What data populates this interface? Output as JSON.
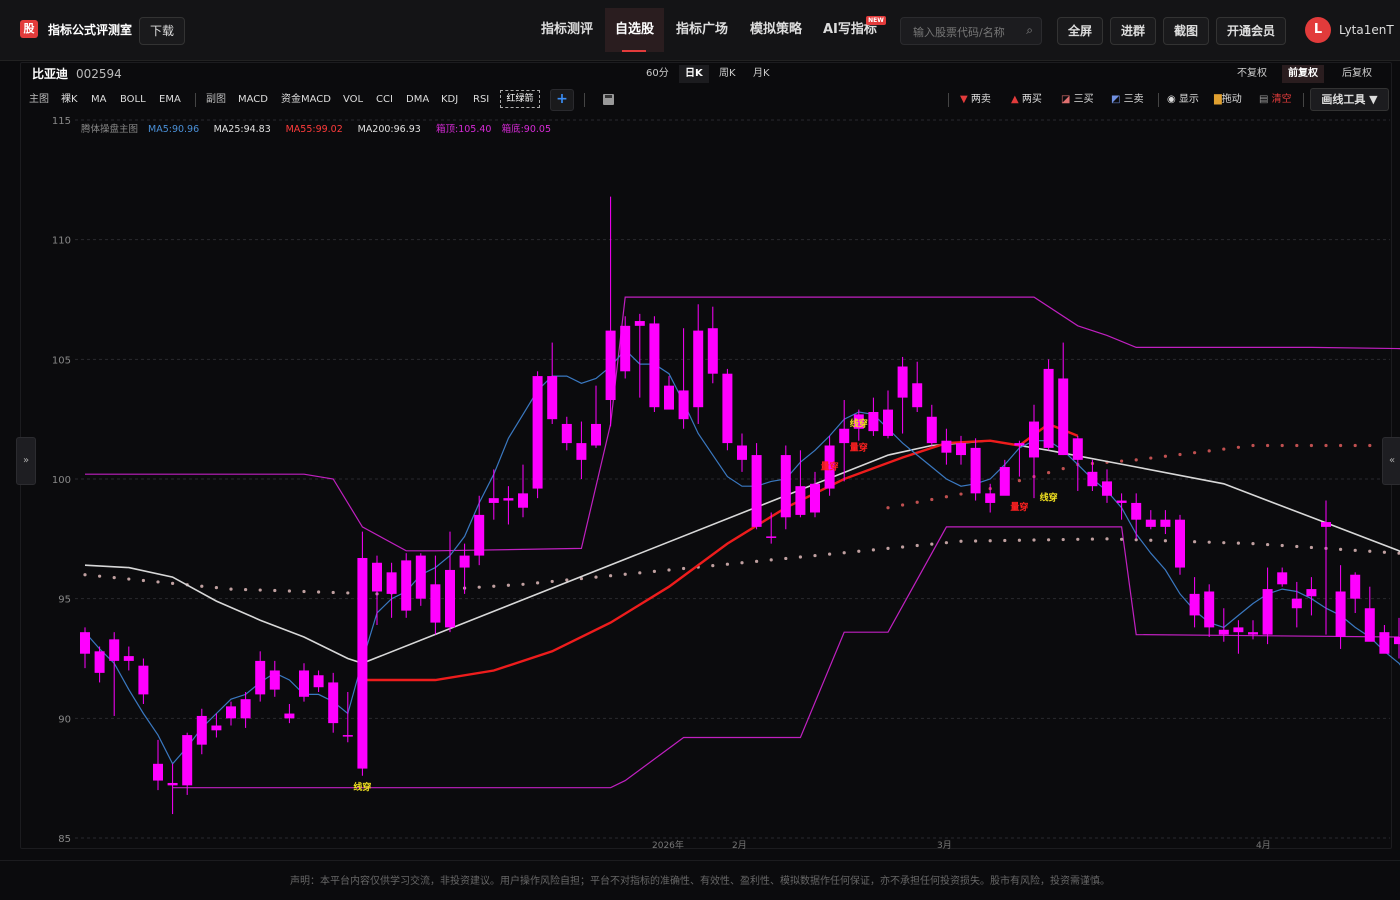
{
  "app": {
    "logo_glyph": "股",
    "title": "指标公式评测室",
    "download_label": "下载",
    "nav": [
      "指标测评",
      "自选股",
      "指标广场",
      "模拟策略",
      "AI写指标"
    ],
    "nav_active_index": 1,
    "new_badge": "NEW",
    "search_placeholder": "输入股票代码/名称",
    "buttons": [
      "全屏",
      "进群",
      "截图",
      "开通会员"
    ],
    "avatar_letter": "L",
    "username": "Lyta1enT"
  },
  "stock": {
    "name": "比亚迪",
    "code": "002594"
  },
  "periods": [
    "60分",
    "日K",
    "周K",
    "月K"
  ],
  "period_active_index": 1,
  "adjust": [
    "不复权",
    "前复权",
    "后复权"
  ],
  "adjust_active_index": 1,
  "indicators": {
    "main_label": "主图",
    "main": [
      "裸K",
      "MA",
      "BOLL",
      "EMA"
    ],
    "sub_label": "副图",
    "sub": [
      "MACD",
      "资金MACD",
      "VOL",
      "CCI",
      "DMA",
      "KDJ",
      "RSI"
    ],
    "custom": "红绿箭"
  },
  "tools": [
    "两卖",
    "两买",
    "三买",
    "三卖",
    "显示",
    "拖动",
    "清空"
  ],
  "draw_tools_label": "画线工具 ▼",
  "side_tabs": [
    "»",
    "«"
  ],
  "legend": {
    "main_name": "腾体操盘主图",
    "items": [
      {
        "label": "MA5:90.96",
        "color": "#4a8fd6"
      },
      {
        "label": "MA25:94.83",
        "color": "#e0e0e0"
      },
      {
        "label": "MA55:99.02",
        "color": "#ff3b3b"
      },
      {
        "label": "MA200:96.93",
        "color": "#e0e0e0"
      },
      {
        "label": "箱顶:105.40",
        "color": "#d62ad6"
      },
      {
        "label": "箱底:90.05",
        "color": "#d62ad6"
      }
    ]
  },
  "chart_data": {
    "type": "candlestick",
    "y_ticks": [
      115,
      110,
      105,
      100,
      95,
      90,
      85
    ],
    "ylim": [
      85,
      115
    ],
    "x_tick_labels": [
      "2026年",
      "2月",
      "3月",
      "4月"
    ],
    "candles": [
      [
        93.6,
        92.7,
        93.8,
        92.1
      ],
      [
        92.8,
        91.9,
        93.0,
        91.5
      ],
      [
        92.4,
        93.3,
        93.6,
        90.1
      ],
      [
        92.6,
        92.4,
        93.0,
        92.0
      ],
      [
        92.2,
        91.0,
        92.5,
        90.6
      ],
      [
        88.1,
        87.4,
        89.1,
        87.0
      ],
      [
        87.2,
        87.3,
        88.1,
        86.0
      ],
      [
        87.2,
        89.3,
        89.4,
        86.8
      ],
      [
        88.9,
        90.1,
        90.4,
        88.5
      ],
      [
        89.7,
        89.5,
        90.2,
        89.2
      ],
      [
        90.0,
        90.5,
        90.7,
        89.7
      ],
      [
        90.0,
        90.8,
        91.1,
        89.6
      ],
      [
        91.0,
        92.4,
        92.8,
        90.7
      ],
      [
        91.2,
        92.0,
        92.4,
        90.9
      ],
      [
        90.2,
        90.0,
        90.6,
        89.8
      ],
      [
        90.9,
        92.0,
        92.3,
        90.7
      ],
      [
        91.3,
        91.8,
        92.0,
        91.1
      ],
      [
        89.8,
        91.5,
        91.9,
        89.4
      ],
      [
        89.3,
        89.3,
        91.1,
        89.0
      ],
      [
        87.9,
        96.7,
        97.8,
        87.6
      ],
      [
        95.3,
        96.5,
        96.8,
        93.9
      ],
      [
        96.1,
        95.2,
        96.5,
        94.2
      ],
      [
        94.5,
        96.6,
        96.9,
        94.2
      ],
      [
        96.8,
        95.0,
        96.9,
        94.7
      ],
      [
        95.6,
        94.0,
        96.8,
        93.5
      ],
      [
        93.8,
        96.2,
        97.8,
        93.6
      ],
      [
        96.3,
        96.8,
        97.3,
        95.2
      ],
      [
        96.8,
        98.5,
        99.3,
        96.4
      ],
      [
        99.2,
        99.0,
        100.4,
        98.3
      ],
      [
        99.1,
        99.2,
        99.7,
        98.1
      ],
      [
        98.8,
        99.4,
        100.6,
        98.4
      ],
      [
        99.6,
        104.3,
        104.5,
        99.2
      ],
      [
        104.3,
        102.5,
        105.7,
        102.3
      ],
      [
        102.3,
        101.5,
        102.6,
        101.2
      ],
      [
        101.5,
        100.8,
        102.4,
        100.0
      ],
      [
        101.4,
        102.3,
        103.9,
        101.3
      ],
      [
        103.3,
        106.2,
        111.8,
        102.2
      ],
      [
        104.5,
        106.4,
        106.8,
        104.2
      ],
      [
        106.4,
        106.6,
        106.9,
        103.4
      ],
      [
        106.5,
        103.0,
        106.8,
        102.8
      ],
      [
        102.9,
        103.9,
        104.3,
        103.0
      ],
      [
        102.5,
        103.7,
        106.3,
        102.1
      ],
      [
        103.0,
        106.2,
        107.3,
        102.3
      ],
      [
        106.3,
        104.4,
        107.2,
        104.0
      ],
      [
        104.4,
        101.5,
        104.6,
        101.2
      ],
      [
        101.4,
        100.8,
        101.9,
        100.3
      ],
      [
        101.0,
        98.0,
        101.5,
        97.9
      ],
      [
        97.6,
        97.6,
        98.6,
        97.3
      ],
      [
        98.4,
        101.0,
        101.4,
        97.9
      ],
      [
        98.5,
        99.7,
        101.2,
        98.4
      ],
      [
        98.6,
        99.8,
        100.3,
        98.4
      ],
      [
        99.6,
        101.4,
        101.8,
        99.3
      ],
      [
        101.5,
        102.1,
        103.3,
        99.9
      ],
      [
        102.1,
        102.7,
        102.9,
        101.6
      ],
      [
        102.0,
        102.8,
        103.4,
        101.8
      ],
      [
        102.9,
        101.8,
        103.7,
        101.7
      ],
      [
        103.4,
        104.7,
        105.1,
        101.9
      ],
      [
        104.0,
        103.0,
        104.9,
        102.8
      ],
      [
        102.6,
        101.5,
        103.1,
        101.4
      ],
      [
        101.6,
        101.1,
        102.1,
        100.6
      ],
      [
        101.0,
        101.5,
        101.8,
        100.6
      ],
      [
        101.3,
        99.4,
        101.7,
        99.1
      ],
      [
        99.4,
        99.0,
        99.8,
        98.6
      ],
      [
        99.3,
        100.5,
        100.8,
        99.4
      ],
      [
        101.4,
        101.5,
        101.6,
        100.1
      ],
      [
        100.9,
        102.4,
        103.1,
        99.2
      ],
      [
        104.6,
        101.3,
        105.0,
        101.2
      ],
      [
        101.0,
        104.2,
        105.7,
        101.0
      ],
      [
        101.7,
        100.8,
        101.8,
        99.5
      ],
      [
        99.7,
        100.3,
        100.8,
        99.5
      ],
      [
        99.3,
        99.9,
        100.4,
        99.0
      ],
      [
        99.0,
        99.1,
        99.4,
        98.3
      ],
      [
        99.0,
        98.3,
        99.4,
        97.5
      ],
      [
        98.3,
        98.0,
        98.7,
        97.9
      ],
      [
        98.0,
        98.3,
        98.7,
        97.7
      ],
      [
        98.3,
        96.3,
        98.5,
        96.0
      ],
      [
        95.2,
        94.3,
        95.9,
        93.8
      ],
      [
        95.3,
        93.8,
        95.6,
        93.4
      ],
      [
        93.5,
        93.7,
        94.6,
        93.2
      ],
      [
        93.6,
        93.8,
        94.1,
        92.7
      ],
      [
        93.6,
        93.5,
        94.1,
        93.3
      ],
      [
        93.5,
        95.4,
        96.3,
        93.1
      ],
      [
        95.6,
        96.1,
        96.3,
        95.5
      ],
      [
        94.6,
        95.0,
        95.7,
        93.8
      ],
      [
        95.1,
        95.4,
        95.9,
        94.3
      ],
      [
        98.2,
        98.0,
        99.1,
        93.5
      ],
      [
        95.3,
        93.4,
        96.4,
        92.9
      ],
      [
        95.0,
        96.0,
        96.1,
        94.4
      ],
      [
        93.2,
        94.6,
        95.5,
        93.6
      ],
      [
        93.6,
        92.7,
        93.9,
        93.1
      ],
      [
        93.1,
        93.4,
        94.2,
        92.5
      ],
      [
        91.3,
        91.2,
        91.8,
        91.0
      ],
      [
        90.8,
        91.6,
        91.9,
        89.8
      ],
      [
        90.4,
        90.9,
        91.2,
        89.7
      ],
      [
        89.7,
        89.9,
        90.4,
        89.1
      ],
      [
        89.9,
        91.5,
        91.6,
        89.3
      ]
    ],
    "ma5": [
      93.6,
      92.9,
      92.3,
      91.2,
      90.2,
      89.3,
      88.1,
      88.8,
      89.6,
      90.2,
      90.8,
      91.0,
      91.5,
      91.9,
      91.6,
      91.0,
      91.0,
      90.7,
      90.2,
      92.4,
      94.4,
      95.0,
      95.3,
      96.0,
      96.3,
      96.8,
      97.6,
      99.0,
      100.2,
      101.7,
      102.7,
      103.7,
      104.3,
      104.3,
      104.0,
      104.2,
      104.7,
      105.4,
      104.8,
      104.8,
      104.4,
      103.2,
      101.9,
      101.0,
      100.1,
      99.7,
      99.7,
      99.9,
      100.0,
      100.7,
      101.2,
      101.8,
      102.5,
      102.8,
      102.7,
      102.1,
      101.5,
      101.0,
      100.5,
      100.0,
      99.7,
      99.8,
      100.0,
      100.6,
      101.3,
      101.6,
      101.6,
      101.2,
      100.6,
      100.0,
      99.5,
      98.8,
      97.7,
      96.9,
      96.2,
      95.2,
      94.5,
      94.0,
      93.8,
      94.3,
      94.8,
      95.2,
      95.4,
      95.3,
      95.0,
      94.6,
      94.3,
      93.8,
      93.4,
      92.8,
      92.3,
      91.5,
      90.9,
      90.3,
      90.4,
      90.9
    ],
    "ma25": [
      {
        "i": 0,
        "v": 96.4
      },
      {
        "i": 3,
        "v": 96.3
      },
      {
        "i": 6,
        "v": 95.9
      },
      {
        "i": 9,
        "v": 94.9
      },
      {
        "i": 12,
        "v": 94.1
      },
      {
        "i": 15,
        "v": 93.4
      },
      {
        "i": 18,
        "v": 92.5
      },
      {
        "i": 19,
        "v": 92.3
      },
      {
        "i": 55,
        "v": 101.0
      },
      {
        "i": 58,
        "v": 101.4
      },
      {
        "i": 62,
        "v": 101.6
      },
      {
        "i": 66,
        "v": 101.2
      },
      {
        "i": 72,
        "v": 100.5
      },
      {
        "i": 78,
        "v": 99.8
      },
      {
        "i": 84,
        "v": 98.4
      },
      {
        "i": 90,
        "v": 97.0
      },
      {
        "i": 96,
        "v": 94.8
      }
    ],
    "ma55": [
      {
        "i": 19,
        "v": 91.6
      },
      {
        "i": 24,
        "v": 91.6
      },
      {
        "i": 28,
        "v": 92.0
      },
      {
        "i": 32,
        "v": 92.8
      },
      {
        "i": 36,
        "v": 94.0
      },
      {
        "i": 40,
        "v": 95.5
      },
      {
        "i": 44,
        "v": 97.3
      },
      {
        "i": 48,
        "v": 98.8
      },
      {
        "i": 52,
        "v": 100.0
      },
      {
        "i": 56,
        "v": 100.9
      },
      {
        "i": 59,
        "v": 101.5
      },
      {
        "i": 62,
        "v": 101.6
      },
      {
        "i": 64,
        "v": 101.4
      },
      {
        "i": 66,
        "v": 102.3
      },
      {
        "i": 68,
        "v": 101.8
      }
    ],
    "ma200": [
      {
        "i": 0,
        "v": 96.0
      },
      {
        "i": 10,
        "v": 95.4
      },
      {
        "i": 20,
        "v": 95.2
      },
      {
        "i": 30,
        "v": 95.6
      },
      {
        "i": 40,
        "v": 96.2
      },
      {
        "i": 50,
        "v": 96.8
      },
      {
        "i": 60,
        "v": 97.4
      },
      {
        "i": 70,
        "v": 97.5
      },
      {
        "i": 80,
        "v": 97.3
      },
      {
        "i": 90,
        "v": 96.9
      },
      {
        "i": 96,
        "v": 96.9
      }
    ],
    "box_top": [
      {
        "i": 0,
        "v": 100.2
      },
      {
        "i": 15,
        "v": 100.2
      },
      {
        "i": 17,
        "v": 100.0
      },
      {
        "i": 19,
        "v": 98.0
      },
      {
        "i": 22,
        "v": 97.0
      },
      {
        "i": 24,
        "v": 97.0
      },
      {
        "i": 34,
        "v": 97.1
      },
      {
        "i": 36,
        "v": 102.3
      },
      {
        "i": 37,
        "v": 107.6
      },
      {
        "i": 65,
        "v": 107.6
      },
      {
        "i": 68,
        "v": 106.4
      },
      {
        "i": 70,
        "v": 106.0
      },
      {
        "i": 72,
        "v": 105.5
      },
      {
        "i": 84,
        "v": 105.5
      },
      {
        "i": 96,
        "v": 105.4
      }
    ],
    "box_bottom": [
      {
        "i": 6,
        "v": 87.1
      },
      {
        "i": 36,
        "v": 87.1
      },
      {
        "i": 37,
        "v": 87.4
      },
      {
        "i": 41,
        "v": 89.2
      },
      {
        "i": 49,
        "v": 89.2
      },
      {
        "i": 52,
        "v": 93.6
      },
      {
        "i": 55,
        "v": 93.6
      },
      {
        "i": 59,
        "v": 98.0
      },
      {
        "i": 60,
        "v": 98.0
      },
      {
        "i": 61,
        "v": 98.0
      },
      {
        "i": 71,
        "v": 98.0
      },
      {
        "i": 72,
        "v": 93.5
      },
      {
        "i": 90,
        "v": 93.4
      }
    ],
    "signals": [
      {
        "i": 19,
        "v": 87.0,
        "text": "线穿",
        "color": "#f0e020"
      },
      {
        "i": 51,
        "v": 100.4,
        "text": "量穿",
        "color": "#ff2020"
      },
      {
        "i": 53,
        "v": 101.2,
        "text": "量穿",
        "color": "#ff2020"
      },
      {
        "i": 53,
        "v": 102.2,
        "text": "线穿",
        "color": "#f0e020"
      },
      {
        "i": 64,
        "v": 98.7,
        "text": "量穿",
        "color": "#ff2020"
      },
      {
        "i": 66,
        "v": 99.1,
        "text": "线穿",
        "color": "#f0e020"
      }
    ]
  },
  "disclaimer": "声明：本平台内容仅供学习交流，非投资建议。用户操作风险自担；平台不对指标的准确性、有效性、盈利性、模拟数据作任何保证，亦不承担任何投资损失。股市有风险，投资需谨慎。"
}
